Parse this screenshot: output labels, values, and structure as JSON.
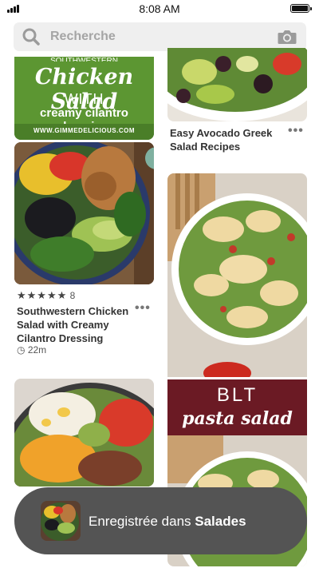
{
  "status_bar": {
    "time": "8:08 AM"
  },
  "search": {
    "placeholder": "Recherche"
  },
  "pins": {
    "chicken_poster": {
      "header_text": "SOUTHWESTERN",
      "line1": "Chicken Salad",
      "line2": "WITH",
      "line3": "creamy cilantro dressing",
      "url": "WWW.GIMMEDELICIOUS.COM"
    },
    "southwestern": {
      "rating_count": "8",
      "title": "Southwestern Chicken Salad with Creamy Cilantro Dressing",
      "duration": "22m"
    },
    "avocado_greek": {
      "title": "Easy Avocado Greek Salad Recipes"
    },
    "blt": {
      "line1": "BLT",
      "line2": "pasta salad"
    }
  },
  "toast": {
    "prefix": "Enregistrée dans",
    "board": "Salades"
  },
  "colors": {
    "poster_green": "#5c9632",
    "blt_maroon": "#6b1a24",
    "toast_bg": "#545454",
    "search_bg": "#efefef"
  },
  "icons": [
    "signal-icon",
    "battery-icon",
    "search-icon",
    "camera-icon",
    "more-icon",
    "star-icon",
    "clock-icon"
  ]
}
